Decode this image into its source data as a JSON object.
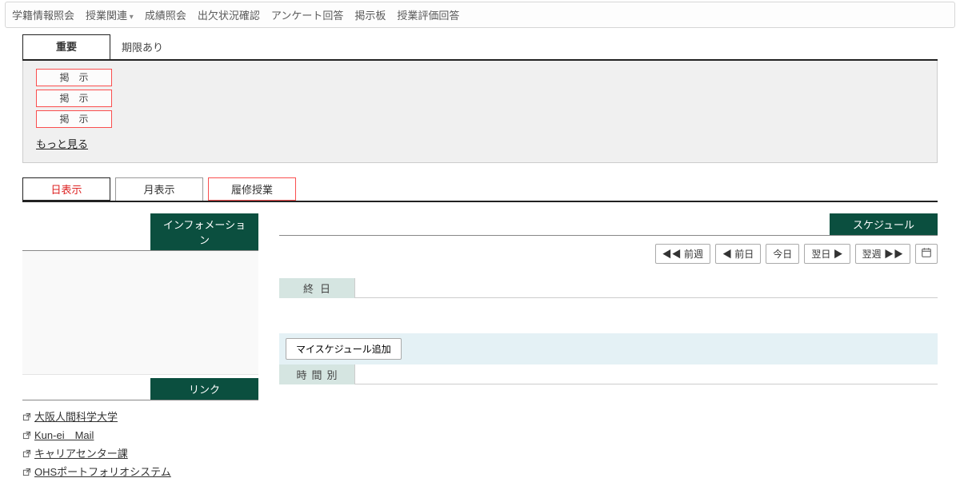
{
  "topMenu": {
    "items": [
      {
        "label": "学籍情報照会",
        "dropdown": false
      },
      {
        "label": "授業関連",
        "dropdown": true
      },
      {
        "label": "成績照会",
        "dropdown": false
      },
      {
        "label": "出欠状況確認",
        "dropdown": false
      },
      {
        "label": "アンケート回答",
        "dropdown": false
      },
      {
        "label": "掲示板",
        "dropdown": false
      },
      {
        "label": "授業評価回答",
        "dropdown": false
      }
    ]
  },
  "importantTabs": {
    "active": "重要",
    "deadline": "期限あり"
  },
  "notices": {
    "badge": "掲示",
    "more": "もっと見る"
  },
  "viewTabs": {
    "day": "日表示",
    "month": "月表示",
    "registered": "履修授業"
  },
  "information": {
    "header": "インフォメーション"
  },
  "links": {
    "header": "リンク",
    "items": [
      "大阪人間科学大学",
      "Kun-ei　Mail",
      "キャリアセンター課",
      "OHSポートフォリオシステム"
    ]
  },
  "schedule": {
    "header": "スケジュール",
    "nav": {
      "prevWeek": "◀◀ 前週",
      "prevDay": "◀ 前日",
      "today": "今日",
      "nextDay": "翌日 ▶",
      "nextWeek": "翌週 ▶▶"
    },
    "allDay": "終日",
    "addMySchedule": "マイスケジュール追加",
    "hourly": "時間別"
  }
}
